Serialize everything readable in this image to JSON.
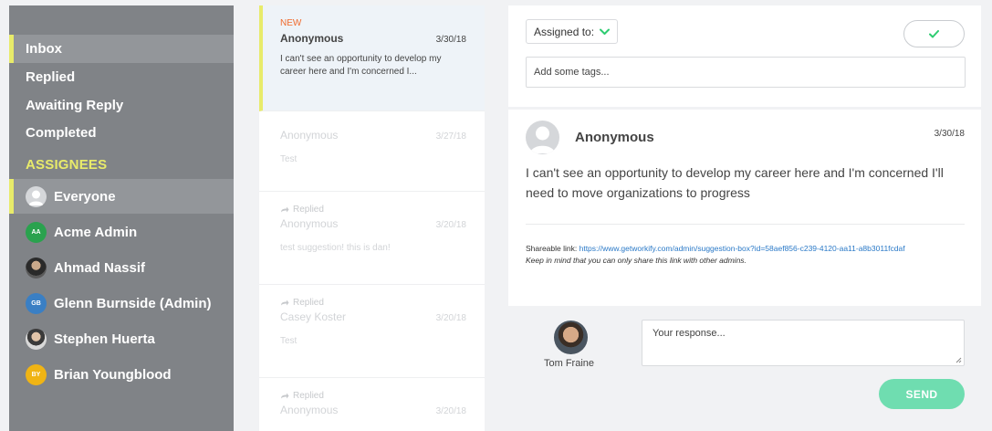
{
  "sidebar": {
    "nav": [
      {
        "label": "Inbox",
        "active": true
      },
      {
        "label": "Replied",
        "active": false
      },
      {
        "label": "Awaiting Reply",
        "active": false
      },
      {
        "label": "Completed",
        "active": false
      }
    ],
    "assignees_title": "Assignees",
    "assignees": [
      {
        "label": "Everyone",
        "initials": "",
        "avatar": "generic-person-icon",
        "color": "#d5d7da",
        "active": true
      },
      {
        "label": "Acme Admin",
        "initials": "AA",
        "avatar": "initials",
        "color": "#2aa24e",
        "active": false
      },
      {
        "label": "Ahmad Nassif",
        "initials": "",
        "avatar": "photo",
        "color": "#2a2a2a",
        "active": false
      },
      {
        "label": "Glenn Burnside (Admin)",
        "initials": "GB",
        "avatar": "initials",
        "color": "#3a7fc4",
        "active": false
      },
      {
        "label": "Stephen Huerta",
        "initials": "",
        "avatar": "photo",
        "color": "#3a3a3a",
        "active": false
      },
      {
        "label": "Brian Youngblood",
        "initials": "BY",
        "avatar": "initials",
        "color": "#f0b414",
        "active": false
      }
    ]
  },
  "messages": [
    {
      "badge": "New",
      "status": "",
      "sender": "Anonymous",
      "date": "3/30/18",
      "snippet": "I can't see an opportunity to develop my career here and I'm concerned I...",
      "selected": true
    },
    {
      "badge": "",
      "status": "",
      "sender": "Anonymous",
      "date": "3/27/18",
      "snippet": "Test",
      "selected": false
    },
    {
      "badge": "",
      "status": "Replied",
      "sender": "Anonymous",
      "date": "3/20/18",
      "snippet": "test suggestion! this is dan!",
      "selected": false
    },
    {
      "badge": "",
      "status": "Replied",
      "sender": "Casey Koster",
      "date": "3/20/18",
      "snippet": "Test",
      "selected": false
    },
    {
      "badge": "",
      "status": "Replied",
      "sender": "Anonymous",
      "date": "3/20/18",
      "snippet": "",
      "selected": false
    }
  ],
  "detail": {
    "assigned_label": "Assigned to:",
    "tags_placeholder": "Add some tags...",
    "author": "Anonymous",
    "date": "3/30/18",
    "body": "I can't see an opportunity to develop my career here and I'm concerned I'll need to move organizations to progress",
    "share_label": "Shareable link:",
    "share_url": "https://www.getworkify.com/admin/suggestion-box?id=58aef856-c239-4120-aa11-a8b3011fcdaf",
    "share_note": "Keep in mind that you can only share this link with other admins."
  },
  "reply": {
    "user_name": "Tom Fraine",
    "placeholder": "Your response...",
    "send_label": "Send"
  },
  "colors": {
    "accent_yellow": "#e8eb6a",
    "new_badge": "#f06a2c",
    "send_green": "#6fddb0",
    "check_green": "#2ecc71",
    "link_blue": "#2a79c7"
  }
}
